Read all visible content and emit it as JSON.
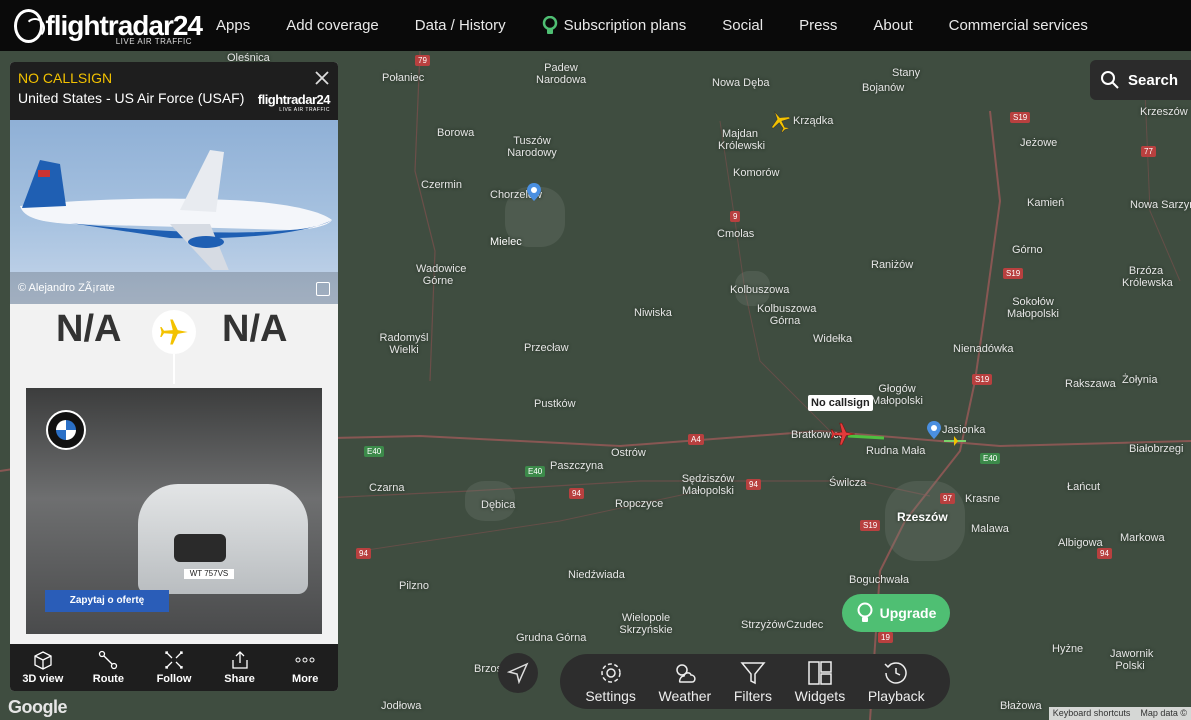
{
  "nav": {
    "logo_text": "flightradar24",
    "logo_tagline": "LIVE AIR TRAFFIC",
    "links": [
      "Apps",
      "Add coverage",
      "Data / History",
      "Subscription plans",
      "Social",
      "Press",
      "About",
      "Commercial services"
    ]
  },
  "search": {
    "label": "Search"
  },
  "flight": {
    "callsign": "NO CALLSIGN",
    "operator": "United States - US Air Force (USAF)",
    "panel_logo": "flightradar24",
    "panel_logo_tag": "LIVE AIR TRAFFIC",
    "photo_credit": "© Alejandro ZÃ¡rate",
    "origin": "N/A",
    "destination": "N/A",
    "ad_cta": "Zapytaj o ofertę",
    "ad_plate": "WT 757VS",
    "tools": [
      {
        "label": "3D view",
        "icon": "cube-icon"
      },
      {
        "label": "Route",
        "icon": "route-icon"
      },
      {
        "label": "Follow",
        "icon": "follow-icon"
      },
      {
        "label": "Share",
        "icon": "share-icon"
      },
      {
        "label": "More",
        "icon": "more-icon"
      }
    ]
  },
  "map": {
    "tooltip": "No callsign",
    "places": [
      "Oleśnica",
      "Połaniec",
      "Padew Narodowa",
      "Nowa Dęba",
      "Stany",
      "Bojanów",
      "Borowa",
      "Tuszów Narodowy",
      "Majdan Królewski",
      "Krządka",
      "Jeżowe",
      "Krzeszów",
      "Czermin",
      "Chorzelów",
      "Komorów",
      "Mielec",
      "Kamień",
      "Nowa Sarzyna",
      "Cmolas",
      "Górno",
      "Wadowice Górne",
      "Raniżów",
      "Brzóza Królewska",
      "Kolbuszowa",
      "Kolbuszowa Górna",
      "Sokołów Małopolski",
      "Niwiska",
      "Radomyśl Wielki",
      "Przecław",
      "Widełka",
      "Nienadówka",
      "Głogów Małopolski",
      "Rakszawa",
      "Żołynia",
      "Pustków",
      "Jasionka",
      "Bratkowice",
      "Rudna Mała",
      "Ostrów",
      "Paszczyna",
      "Sędziszów Małopolski",
      "Białobrzegi",
      "Świlcza",
      "Czarna",
      "Dębica",
      "Ropczyce",
      "Krasne",
      "Łańcut",
      "Rzeszów",
      "Malawa",
      "Albigowa",
      "Markowa",
      "Niedźwiada",
      "Boguchwała",
      "Pilzno",
      "Wielopole Skrzyńskie",
      "Strzyżów",
      "Czudec",
      "Grudna Górna",
      "Hyżne",
      "Brzostek",
      "Jodłowa",
      "Jawornik Polski",
      "Błażowa"
    ],
    "roads": [
      "79",
      "S19",
      "9",
      "77",
      "E40",
      "A4",
      "94",
      "97",
      "19"
    ]
  },
  "toolbar": [
    {
      "label": "Settings",
      "icon": "gear-icon"
    },
    {
      "label": "Weather",
      "icon": "weather-icon"
    },
    {
      "label": "Filters",
      "icon": "filter-icon"
    },
    {
      "label": "Widgets",
      "icon": "widgets-icon"
    },
    {
      "label": "Playback",
      "icon": "playback-icon"
    }
  ],
  "upgrade": {
    "label": "Upgrade"
  },
  "footer": {
    "google": "Google",
    "shortcuts": "Keyboard shortcuts",
    "map_data": "Map data ©"
  },
  "colors": {
    "accent": "#f3c200",
    "upgrade": "#4fbf73",
    "map": "#3f4d40",
    "panel": "#f2f2f2"
  }
}
